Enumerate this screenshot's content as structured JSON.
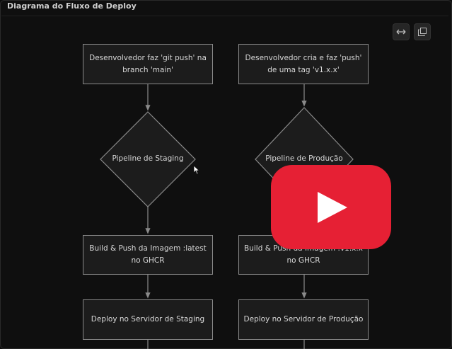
{
  "panel": {
    "title": "Diagrama do Fluxo de Deploy"
  },
  "toolbar": {
    "expand_icon": "expand-horizontal-icon",
    "copy_icon": "copy-icon"
  },
  "diagram": {
    "staging": {
      "trigger": "Desenvolvedor faz 'git push' na branch 'main'",
      "pipeline": "Pipeline de Staging",
      "build": "Build & Push da Imagem :latest no GHCR",
      "deploy": "Deploy no Servidor de Staging"
    },
    "production": {
      "trigger": "Desenvolvedor cria e faz 'push' de uma tag 'v1.x.x'",
      "pipeline": "Pipeline de Produção",
      "build": "Build & Push da Imagem :v1.x.x no GHCR",
      "deploy": "Deploy no Servidor de Produção"
    }
  },
  "video_overlay": {
    "icon": "youtube-play-icon",
    "color": "#e62034"
  },
  "colors": {
    "background": "#0f0f0f",
    "node_fill": "#1c1c1c",
    "stroke": "#8a8a8a"
  }
}
